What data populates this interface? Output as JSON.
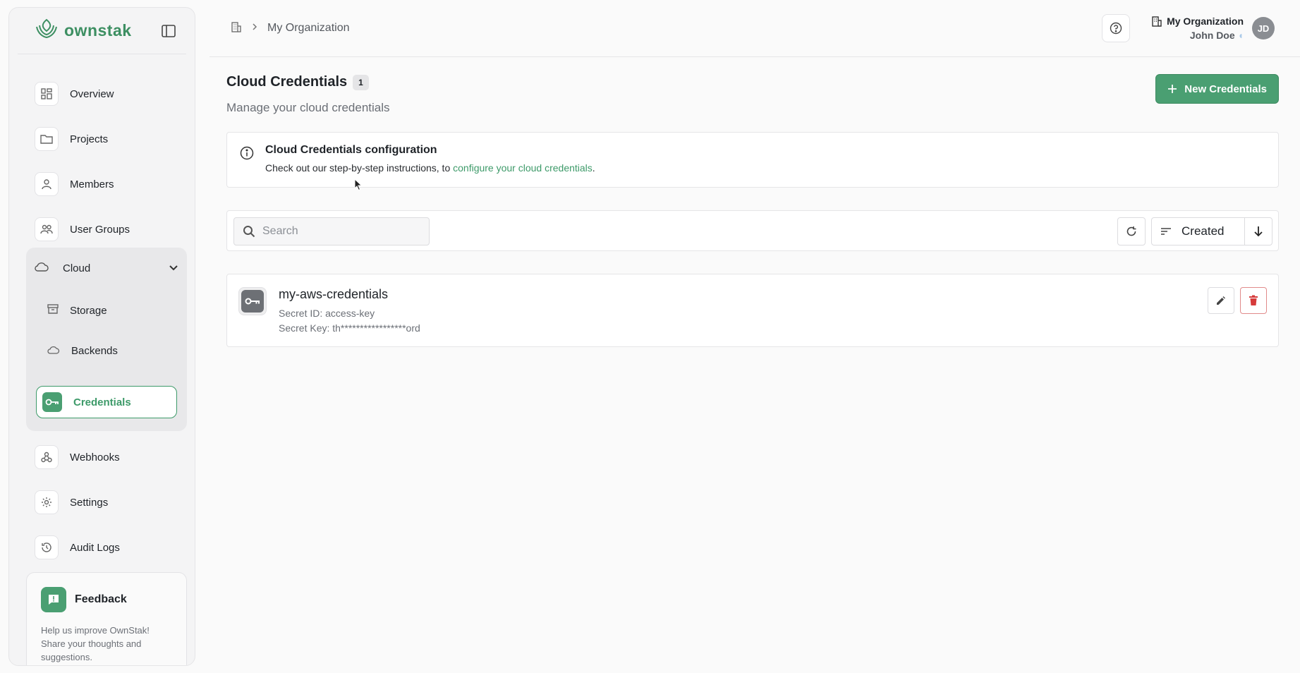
{
  "sidebar": {
    "logo_text": "ownstak",
    "items": [
      {
        "label": "Overview",
        "icon": "grid-icon"
      },
      {
        "label": "Projects",
        "icon": "folder-icon"
      },
      {
        "label": "Members",
        "icon": "user-icon"
      },
      {
        "label": "User Groups",
        "icon": "users-icon"
      }
    ],
    "cloud": {
      "label": "Cloud",
      "sub_items": [
        {
          "label": "Storage",
          "icon": "archive-icon"
        },
        {
          "label": "Backends",
          "icon": "cloud-icon"
        },
        {
          "label": "Credentials",
          "icon": "key-icon",
          "active": true
        }
      ]
    },
    "bottom_items": [
      {
        "label": "Webhooks",
        "icon": "webhook-icon"
      },
      {
        "label": "Settings",
        "icon": "gear-icon"
      },
      {
        "label": "Audit Logs",
        "icon": "history-icon"
      }
    ],
    "feedback": {
      "title": "Feedback",
      "text": "Help us improve OwnStak! Share your thoughts and suggestions."
    }
  },
  "topbar": {
    "breadcrumb": "My Organization",
    "org_name": "My Organization",
    "user_name": "John Doe",
    "avatar_initials": "JD"
  },
  "main": {
    "title": "Cloud Credentials",
    "count": "1",
    "subtitle": "Manage your cloud credentials",
    "new_button": "New Credentials",
    "info": {
      "title": "Cloud Credentials configuration",
      "text_prefix": "Check out our step-by-step instructions, to ",
      "link": "configure your cloud credentials",
      "text_suffix": "."
    },
    "search_placeholder": "Search",
    "sort_label": "Created",
    "credentials": [
      {
        "name": "my-aws-credentials",
        "secret_id": "Secret ID: access-key",
        "secret_key": "Secret Key: th*****************ord"
      }
    ]
  },
  "colors": {
    "accent": "#4a9f72",
    "danger": "#d63b3b"
  }
}
